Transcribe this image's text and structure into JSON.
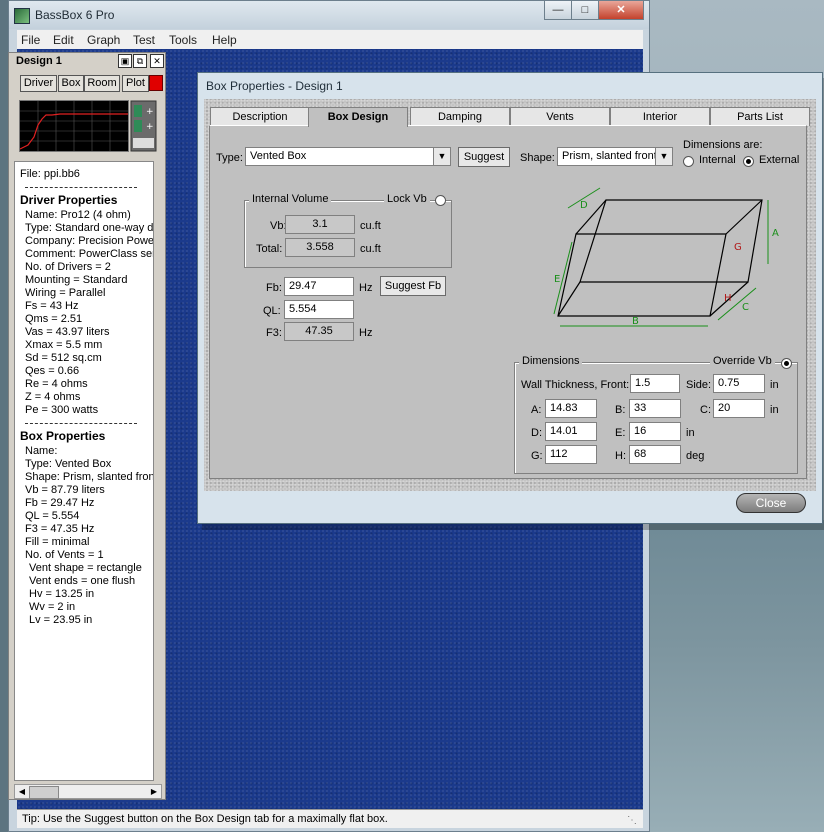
{
  "app": {
    "title": "BassBox 6 Pro",
    "menu": [
      "File",
      "Edit",
      "Graph",
      "Test",
      "Tools",
      "Help"
    ],
    "status": "Tip: Use the Suggest button on the Box Design tab for a maximally flat box."
  },
  "design_panel": {
    "title": "Design 1",
    "buttons": [
      "Driver",
      "Box",
      "Room",
      "Plot"
    ],
    "file": "File: ppi.bb6",
    "driver_header": "Driver Properties",
    "driver_lines": [
      "Name: Pro12  (4 ohm)",
      "Type: Standard one-way driv",
      "Company: Precision Power",
      "Comment: PowerClass series",
      "No. of Drivers = 2",
      "Mounting = Standard",
      "Wiring = Parallel",
      "Fs =  43 Hz",
      "Qms =  2.51",
      "Vas =  43.97 liters",
      "Xmax =  5.5 mm",
      "Sd =  512 sq.cm",
      "Qes =  0.66",
      "Re =  4 ohms",
      "Z =  4 ohms",
      "Pe =  300 watts"
    ],
    "box_header": "Box Properties",
    "box_lines": [
      "Name:",
      "Type: Vented Box",
      "Shape: Prism, slanted front",
      "Vb =  87.79 liters",
      "Fb =  29.47 Hz",
      "QL =  5.554",
      "F3 =  47.35 Hz",
      "Fill = minimal",
      "No. of Vents = 1",
      "Vent shape = rectangle",
      "Vent ends = one flush",
      "Hv =  13.25 in",
      "Wv =  2 in",
      "Lv =  23.95 in"
    ]
  },
  "dialog": {
    "title": "Box Properties - Design 1",
    "tabs": [
      "Description",
      "Box Design",
      "Damping",
      "Vents",
      "Interior",
      "Parts List"
    ],
    "active_tab": "Box Design",
    "type_label": "Type:",
    "type_value": "Vented Box",
    "suggest_label": "Suggest",
    "shape_label": "Shape:",
    "shape_value": "Prism, slanted front",
    "dims_are_label": "Dimensions are:",
    "dims_internal": "Internal",
    "dims_external": "External",
    "internal_volume_label": "Internal Volume",
    "lock_vb_label": "Lock Vb",
    "vb_label": "Vb:",
    "vb_value": "3.1",
    "vb_unit": "cu.ft",
    "total_label": "Total:",
    "total_value": "3.558",
    "total_unit": "cu.ft",
    "fb_label": "Fb:",
    "fb_value": "29.47",
    "fb_unit": "Hz",
    "suggest_fb_label": "Suggest Fb",
    "ql_label": "QL:",
    "ql_value": "5.554",
    "f3_label": "F3:",
    "f3_value": "47.35",
    "f3_unit": "Hz",
    "diagram_letters": [
      "D",
      "A",
      "G",
      "E",
      "H",
      "C",
      "B"
    ],
    "dimensions_label": "Dimensions",
    "override_vb_label": "Override Vb",
    "wall_front_label": "Wall Thickness, Front:",
    "wall_front_value": "1.5",
    "side_label": "Side:",
    "side_value": "0.75",
    "in_unit": "in",
    "a_label": "A:",
    "a_value": "14.83",
    "b_label": "B:",
    "b_value": "33",
    "c_label": "C:",
    "c_value": "20",
    "d_label": "D:",
    "d_value": "14.01",
    "e_label": "E:",
    "e_value": "16",
    "g_label": "G:",
    "g_value": "112",
    "h_label": "H:",
    "h_value": "68",
    "deg_unit": "deg",
    "close_label": "Close"
  },
  "colors": {
    "client_blue": "#1b3a8c",
    "dim_green": "#1a8f1a",
    "dim_red": "#b01818",
    "plot_red": "#e00000"
  }
}
